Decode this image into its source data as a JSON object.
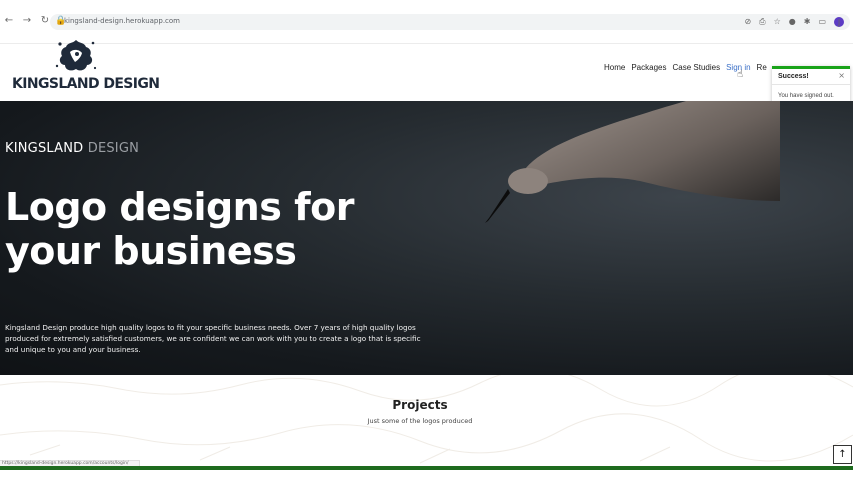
{
  "browser": {
    "url": "kingsland-design.herokuapp.com",
    "back_icon": "arrow-left-icon",
    "forward_icon": "arrow-right-icon",
    "reload_icon": "reload-icon",
    "profile_initial": "J"
  },
  "header": {
    "logo_text": "KINGSLAND DESIGN",
    "nav": [
      {
        "label": "Home"
      },
      {
        "label": "Packages"
      },
      {
        "label": "Case Studies"
      },
      {
        "label": "Sign in"
      },
      {
        "label": "Re"
      }
    ]
  },
  "toast": {
    "title": "Success!",
    "close": "×",
    "message": "You have signed out.",
    "accent_color": "#19a319"
  },
  "hero": {
    "brand_first": "KINGSLAND",
    "brand_second": "DESIGN",
    "headline": "Logo designs for your business",
    "description": "Kingsland Design produce high quality logos to fit your specific business needs. Over 7 years of high quality logos produced for extremely satisfied customers, we are confident we can work with you to create a logo that is specific and unique to you and your business."
  },
  "projects": {
    "title": "Projects",
    "subtitle": "Just some of the logos produced"
  },
  "status_bar": {
    "text": "https://kingsland-design.herokuapp.com/accounts/login/"
  },
  "scroll_top": {
    "icon": "arrow-up-icon",
    "glyph": "↑"
  }
}
